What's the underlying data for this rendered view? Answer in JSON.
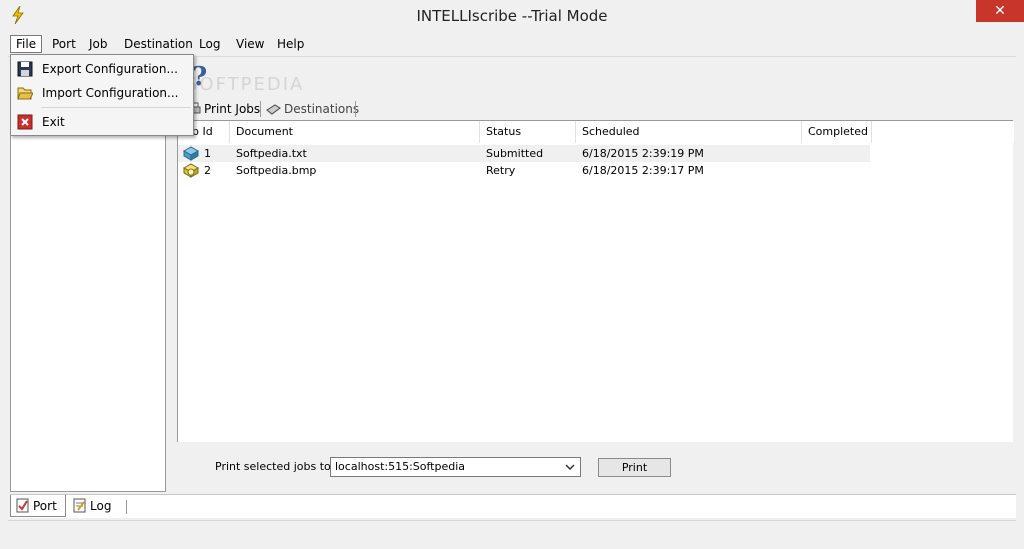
{
  "window": {
    "title": "INTELLIscribe --Trial Mode",
    "close_label": "✕"
  },
  "menubar": {
    "items": [
      "File",
      "Port",
      "Job",
      "Destination",
      "Log",
      "View",
      "Help"
    ]
  },
  "file_menu": {
    "items": [
      "Export Configuration...",
      "Import Configuration...",
      "Exit"
    ]
  },
  "tabs": {
    "print_jobs": "Print Jobs",
    "destinations": "Destinations"
  },
  "jobs_table": {
    "columns": [
      "b Id",
      "Document",
      "Status",
      "Scheduled",
      "Completed"
    ],
    "rows": [
      {
        "id": "1",
        "document": "Softpedia.txt",
        "status": "Submitted",
        "scheduled": "6/18/2015 2:39:19 PM",
        "completed": ""
      },
      {
        "id": "2",
        "document": "Softpedia.bmp",
        "status": "Retry",
        "scheduled": "6/18/2015 2:39:17 PM",
        "completed": ""
      }
    ]
  },
  "print_bar": {
    "label": "Print selected jobs to:",
    "destination_value": "localhost:515:Softpedia",
    "print_button": "Print"
  },
  "bottom_tabs": {
    "port": "Port",
    "log": "Log"
  },
  "watermark": {
    "text": "SOFTPEDIA"
  },
  "colors": {
    "close_button": "#c7352b",
    "menu_highlight": "#ffffff"
  }
}
